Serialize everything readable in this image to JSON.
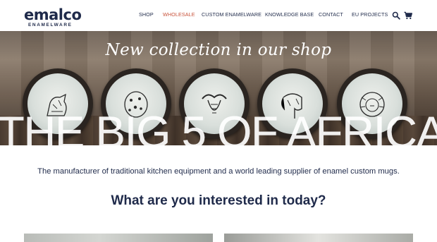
{
  "brand": {
    "name": "emalco",
    "sub": "ENAMELWARE"
  },
  "nav": {
    "items": [
      {
        "label": "SHOP",
        "active": false
      },
      {
        "label": "WHOLESALE",
        "active": true
      },
      {
        "label": "CUSTOM ENAMELWARE",
        "active": false
      },
      {
        "label": "KNOWLEDGE BASE",
        "active": false
      },
      {
        "label": "CONTACT",
        "active": false
      },
      {
        "label": "EU PROJECTS",
        "active": false
      }
    ],
    "icons": [
      "search-icon",
      "cart-icon"
    ]
  },
  "hero": {
    "script": "New collection in our shop",
    "headline": "THE BIG 5 OF AFRICA"
  },
  "main": {
    "tagline": "The manufacturer of traditional kitchen equipment and a world leading supplier of enamel custom mugs.",
    "question": "What are you interested in today?"
  },
  "colors": {
    "text": "#1f2a4a",
    "accent": "#c8523a"
  }
}
